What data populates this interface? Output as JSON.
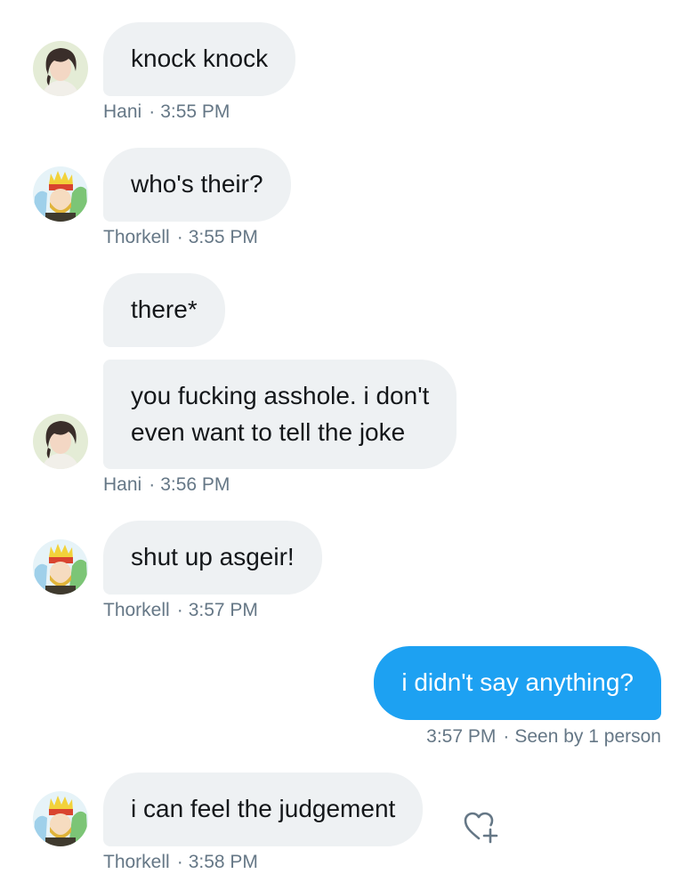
{
  "messages": [
    {
      "sender": "Hani",
      "text": "knock knock",
      "time": "3:55 PM"
    },
    {
      "sender": "Thorkell",
      "text": "who's their?",
      "time": "3:55 PM"
    },
    {
      "sender": "Hani",
      "text": "there*"
    },
    {
      "sender": "Hani",
      "text_line1": "you fucking asshole. i don't",
      "text_line2": "even want to tell the joke",
      "time": "3:56 PM"
    },
    {
      "sender": "Thorkell",
      "text": "shut up asgeir!",
      "time": "3:57 PM"
    },
    {
      "sender": "me",
      "text": "i didn't say anything?",
      "time": "3:57 PM",
      "status": "Seen by 1 person"
    },
    {
      "sender": "Thorkell",
      "text": "i can feel the judgement",
      "time": "3:58 PM"
    }
  ],
  "separator": "·",
  "icons": {
    "avatar_hani": "avatar-hani",
    "avatar_thorkell": "avatar-thorkell",
    "react": "heart-plus-icon"
  },
  "colors": {
    "received_bubble": "#eef1f3",
    "sent_bubble": "#1da1f2",
    "meta_text": "#657786"
  }
}
